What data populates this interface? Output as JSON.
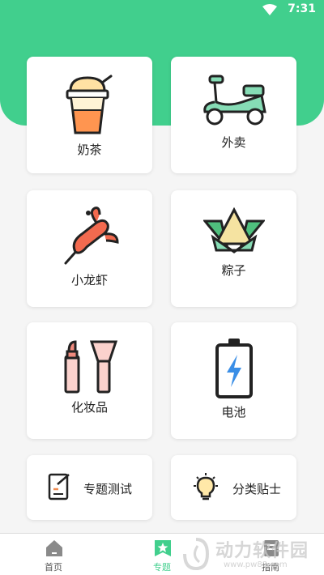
{
  "status_bar": {
    "time": "7:31"
  },
  "colors": {
    "accent": "#41cf8d",
    "card_bg": "#ffffff",
    "page_bg": "#f5f5f5"
  },
  "cards": [
    {
      "label": "奶茶",
      "icon": "milk-tea-icon"
    },
    {
      "label": "外卖",
      "icon": "delivery-scooter-icon"
    },
    {
      "label": "小龙虾",
      "icon": "crayfish-icon"
    },
    {
      "label": "粽子",
      "icon": "zongzi-icon"
    },
    {
      "label": "化妆品",
      "icon": "cosmetics-icon"
    },
    {
      "label": "电池",
      "icon": "battery-icon"
    }
  ],
  "quick_actions": [
    {
      "label": "专题测试",
      "icon": "quiz-icon"
    },
    {
      "label": "分类贴士",
      "icon": "lightbulb-icon"
    }
  ],
  "tabbar": [
    {
      "label": "首页",
      "icon": "home-icon",
      "active": false
    },
    {
      "label": "专题",
      "icon": "star-bookmark-icon",
      "active": true
    },
    {
      "label": "指南",
      "icon": "guide-icon",
      "active": false
    }
  ],
  "watermark": {
    "text": "动力软件园",
    "url": "www.pw88.com"
  }
}
